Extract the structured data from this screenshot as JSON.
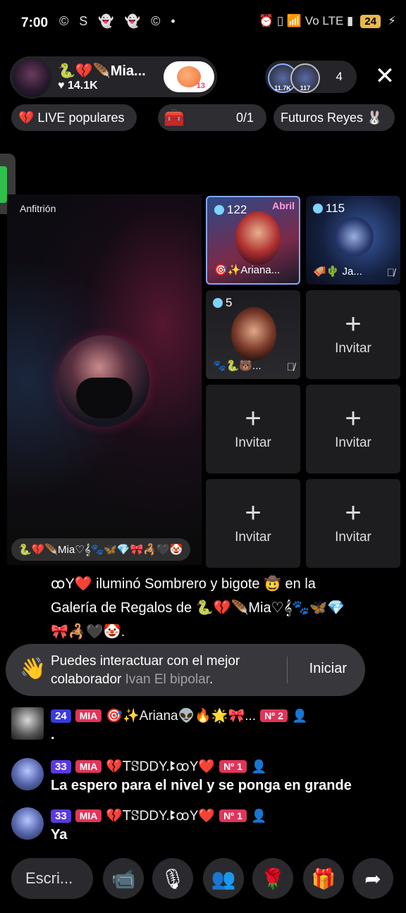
{
  "status_bar": {
    "time": "7:00",
    "left_icons": "© S 👻 👻 © •",
    "right_icons": "⏰ ▯ 📶 Vo LTE ▮",
    "battery": "24"
  },
  "host": {
    "name": "🐍💔🪶Mia...",
    "likes": "♥ 14.1K",
    "follow_badge": "13"
  },
  "viewers": {
    "avatar1_badge": "11.7K",
    "avatar2_badge": "117",
    "count": "4"
  },
  "chips": {
    "live_popular": "💔 LIVE populares",
    "chest_progress": "0/1",
    "future_kings": "Futuros Reyes 🐰"
  },
  "host_video": {
    "label": "Anfitrión",
    "bottom_name": "🐍💔🪶Mia♡𝄞🐾🦋💎🎀🦂🖤🤡"
  },
  "seats": [
    {
      "count": "122",
      "name": "🎯✨Ariana...",
      "banner": "Abril"
    },
    {
      "count": "115",
      "name": "🪗🌵 Ja..."
    },
    {
      "count": "5",
      "name": "🐾🐍🐻..."
    },
    {
      "invite": "Invitar"
    },
    {
      "invite": "Invitar"
    },
    {
      "invite": "Invitar"
    },
    {
      "invite": "Invitar"
    },
    {
      "invite": "Invitar"
    }
  ],
  "gift_message": {
    "line1": "ꝏY❤️ iluminó Sombrero y bigote 🤠 en la",
    "line2": "Galería de Regalos de 🐍💔🪶Mia♡𝄞🐾🦋💎",
    "line3": "🎀🦂🖤🤡."
  },
  "interact_banner": {
    "text": "Puedes interactuar con el mejor colaborador",
    "highlight": "Ivan El bipolar",
    "suffix": ".",
    "button": "Iniciar"
  },
  "messages": [
    {
      "level": "24",
      "fan": "MIA",
      "user": "🎯✨Ariana👽🔥🌟🎀...",
      "rank": "Nº 2",
      "text": "."
    },
    {
      "level": "33",
      "fan": "MIA",
      "user": "💔ꓔꗟDDY.ꔪꝏY❤️",
      "rank": "Nº 1",
      "text": "La espero para el nivel y se ponga en grande"
    },
    {
      "level": "33",
      "fan": "MIA",
      "user": "💔ꓔꗟDDY.ꔪꝏY❤️",
      "rank": "Nº 1",
      "text": "Ya"
    }
  ],
  "toolbar": {
    "input_placeholder": "Escri...",
    "icons": [
      "video-icon",
      "microphone-icon",
      "guests-icon",
      "rose-icon",
      "gift-icon",
      "share-icon"
    ]
  }
}
